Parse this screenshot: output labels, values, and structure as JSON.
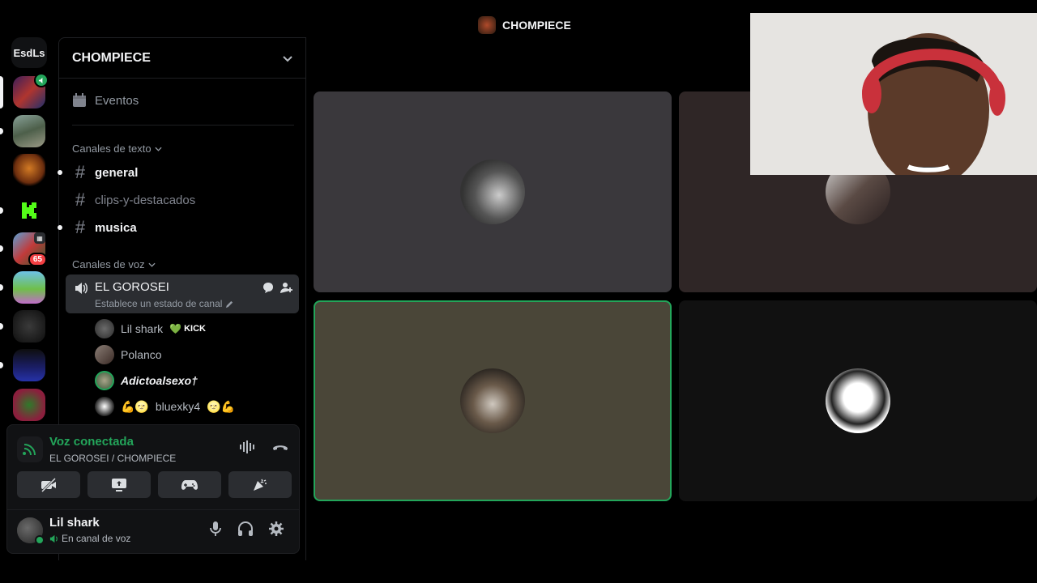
{
  "rail": {
    "folder_label": "EsdLs",
    "unread_badge": "65"
  },
  "server": {
    "name": "CHOMPIECE"
  },
  "sidebar": {
    "events_label": "Eventos",
    "text_category": "Canales de texto",
    "voice_category": "Canales de voz",
    "text_channels": [
      {
        "name": "general",
        "unread": true
      },
      {
        "name": "clips-y-destacados",
        "unread": false
      },
      {
        "name": "musica",
        "unread": true
      }
    ],
    "voice_channel": {
      "name": "EL GOROSEI",
      "status_placeholder": "Establece un estado de canal"
    },
    "members": [
      {
        "name": "Lil shark",
        "tag": "KICK"
      },
      {
        "name": "Polanco"
      },
      {
        "name": "Adictoalsexo†"
      },
      {
        "name": "bluexky4"
      }
    ]
  },
  "panel": {
    "voice_title": "Voz conectada",
    "voice_location": "EL GOROSEI / CHOMPIECE",
    "user_name": "Lil shark",
    "user_status": "En canal de voz"
  },
  "call": {
    "title": "CHOMPIECE",
    "speaking_color": "#23a55a"
  },
  "colors": {
    "accent_green": "#23a55a",
    "danger_red": "#f23f43",
    "kick_green": "#53fc18"
  }
}
